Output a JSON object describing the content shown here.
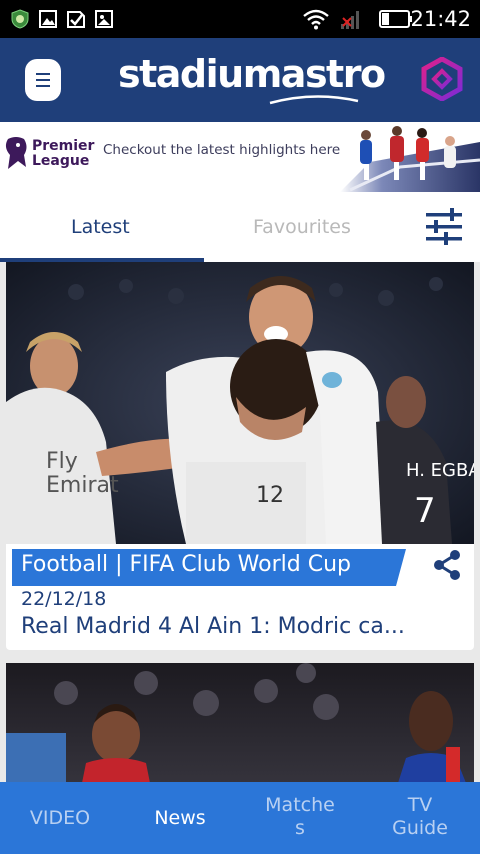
{
  "status_bar": {
    "time": "21:42",
    "icons": [
      "shield-icon",
      "image-icon",
      "check-icon",
      "photo-icon",
      "wifi-icon",
      "signal-icon",
      "battery-icon"
    ]
  },
  "app_bar": {
    "logo": "stadiumastro",
    "menu_icon": "menu-icon",
    "brand_icon": "astro-icon"
  },
  "banner": {
    "league_line1": "Premier",
    "league_line2": "League",
    "message": "Checkout the latest highlights here"
  },
  "tabs": {
    "items": [
      {
        "label": "Latest",
        "active": true
      },
      {
        "label": "Favourites",
        "active": false
      }
    ],
    "filter_icon": "filter-sliders-icon"
  },
  "feed": {
    "cards": [
      {
        "category": "Football | FIFA Club World Cup",
        "date": "22/12/18",
        "headline": "Real Madrid 4 Al Ain 1: Modric ca...",
        "share_icon": "share-icon"
      }
    ]
  },
  "bottom_nav": {
    "items": [
      {
        "label": "VIDEO",
        "active": false
      },
      {
        "label": "News",
        "active": true
      },
      {
        "label": "Matches",
        "label_line1": "Matche",
        "label_line2": "s",
        "active": false
      },
      {
        "label": "TV Guide",
        "label_line1": "TV",
        "label_line2": "Guide",
        "active": false
      }
    ]
  },
  "colors": {
    "primary": "#1f3f7a",
    "accent": "#2b76d8",
    "tag": "#2b76d8"
  }
}
